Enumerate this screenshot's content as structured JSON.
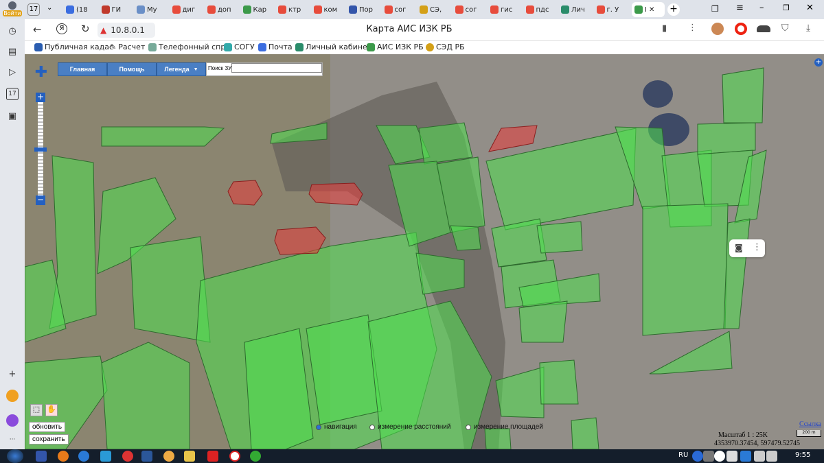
{
  "browser": {
    "tabs": [
      {
        "label": "(18",
        "color": "#3b6de0"
      },
      {
        "label": "ГИ",
        "color": "#c0392b"
      },
      {
        "label": "Му",
        "color": "#6a8fc7"
      },
      {
        "label": "диг",
        "color": "#e74c3c"
      },
      {
        "label": "доп",
        "color": "#e74c3c"
      },
      {
        "label": "Кар",
        "color": "#3c9a4a"
      },
      {
        "label": "ктр",
        "color": "#e74c3c"
      },
      {
        "label": "ком",
        "color": "#e74c3c"
      },
      {
        "label": "Пор",
        "color": "#3355aa"
      },
      {
        "label": "сог",
        "color": "#e74c3c"
      },
      {
        "label": "СЭ,",
        "color": "#d4a017"
      },
      {
        "label": "сог",
        "color": "#e74c3c"
      },
      {
        "label": "гис",
        "color": "#e74c3c"
      },
      {
        "label": "пдс",
        "color": "#e74c3c"
      },
      {
        "label": "Лич",
        "color": "#2a8c6a"
      },
      {
        "label": "г. У",
        "color": "#e74c3c"
      },
      {
        "label": "І",
        "color": "#3c9a4a"
      }
    ],
    "tab_count": "17",
    "profile_label": "Войти",
    "address": "10.8.0.1",
    "page_title": "Карта АИС ИЗК РБ",
    "bookmarks": [
      "Публичная кадас",
      "Расчет",
      "Телефонный спра",
      "СОГУ",
      "Почта",
      "Личный кабинет",
      "АИС ИЗК РБ",
      "СЭД РБ"
    ],
    "sidebar_count": "17"
  },
  "app": {
    "menu": [
      "Главная",
      "Помощь",
      "Легенда"
    ],
    "search_label": "Поиск ЗУ",
    "search_value": "",
    "refresh_button": "обновить",
    "save_button": "сохранить",
    "modes": [
      {
        "label": "навигация",
        "selected": true
      },
      {
        "label": "измерение расстояний",
        "selected": false
      },
      {
        "label": "измерение площадей",
        "selected": false
      }
    ],
    "link_label": "Ссылка",
    "scale_text": "Масштаб 1 : 25K",
    "scalebar_label": "200 m",
    "coords": "4353970.37454, 597479.52745"
  },
  "taskbar": {
    "lang": "RU",
    "time": "9:55"
  },
  "colors": {
    "parcel_green": "#4fe04f",
    "parcel_red": "#e83a3a",
    "menu_blue": "#4a7fc4"
  }
}
